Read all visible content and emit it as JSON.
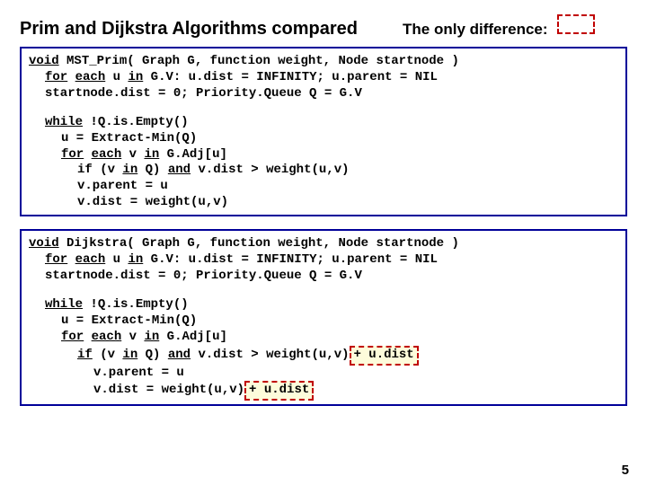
{
  "header": {
    "title": "Prim and Dijkstra Algorithms  compared",
    "subtitle": "The only difference:"
  },
  "kw": {
    "void": "void",
    "for": "for",
    "each": "each",
    "in": "in",
    "while": "while",
    "and": "and",
    "if": "if"
  },
  "prim": {
    "sig1": " MST_Prim( Graph G, function weight, Node startnode )",
    "sig2a": " u ",
    "sig2b": " G.V:   u.dist = INFINITY; u.parent = NIL",
    "sig3": "startnode.dist = 0; Priority.Queue Q = G.V",
    "l1": " !Q.is.Empty()",
    "l2": "u = Extract-Min(Q)",
    "l3a": " v ",
    "l3b": " G.Adj[u]",
    "l4a": "if (v ",
    "l4b": " Q) ",
    "l4c": " v.dist > weight(u,v)",
    "l5": "v.parent = u",
    "l6": "v.dist = weight(u,v)"
  },
  "dij": {
    "sig1": " Dijkstra( Graph G, function weight, Node startnode )",
    "sig2a": " u ",
    "sig2b": " G.V:   u.dist = INFINITY; u.parent = NIL",
    "sig3": "startnode.dist = 0; Priority.Queue Q = G.V",
    "l1": " !Q.is.Empty()",
    "l2": "u = Extract-Min(Q)",
    "l3a": " v ",
    "l3b": " G.Adj[u]",
    "l4a": " (v ",
    "l4b": " Q) ",
    "l4c": " v.dist > weight(u,v)",
    "l4hl": " + u.dist",
    "l5": "v.parent = u",
    "l6a": "v.dist = weight(u,v)",
    "l6hl": " + u.dist"
  },
  "page": "5"
}
